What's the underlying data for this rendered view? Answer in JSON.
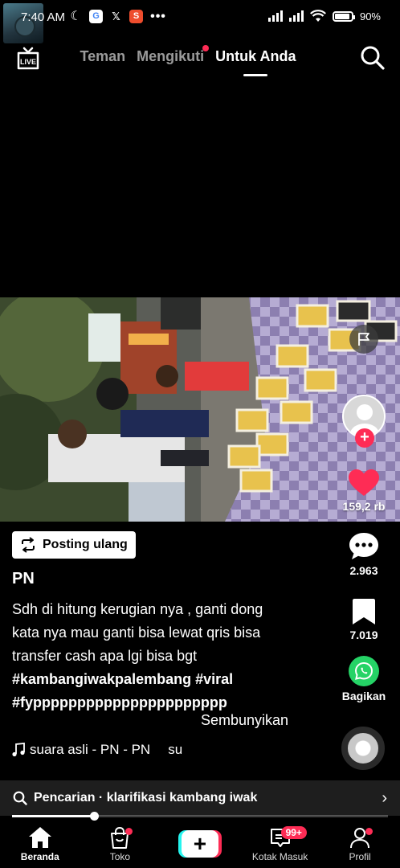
{
  "status_bar": {
    "time": "7:40 AM",
    "battery": "90%",
    "icons": [
      "moon-icon",
      "google-icon",
      "x-icon",
      "shopee-icon",
      "more-dots-icon",
      "signal-icon",
      "signal-icon",
      "wifi-icon",
      "battery-icon"
    ],
    "google_letter": "G",
    "x_letter": "𝕏",
    "shop_letter": "S",
    "dots": "•••",
    "moon": "☾"
  },
  "top_nav": {
    "tabs": [
      {
        "label": "Teman",
        "active": false
      },
      {
        "label": "Mengikuti",
        "active": false,
        "dot": true
      },
      {
        "label": "Untuk Anda",
        "active": true
      }
    ]
  },
  "actions": {
    "likes": "159,2 rb",
    "comments": "2.963",
    "bookmarks": "7.019",
    "share_label": "Bagikan"
  },
  "post": {
    "repost_label": "Posting ulang",
    "username": "PN",
    "caption_lines": [
      "Sdh di hitung kerugian nya , ganti dong",
      "kata nya mau ganti bisa lewat qris bisa",
      "transfer cash apa lgi bisa bgt"
    ],
    "hashtags_line1": "#kambangiwakpalembang #viral",
    "hashtags_line2": "#fypppppppppppppppppppppp",
    "hide_label": "Sembunyikan",
    "sound": "suara asli - PN - PN",
    "sound_extra": "su"
  },
  "search_suggestion": {
    "text": "Pencarian · klarifikasi kambang iwak"
  },
  "playback": {
    "progress": 0.22
  },
  "bottom_nav": {
    "items": [
      {
        "label": "Beranda",
        "active": true
      },
      {
        "label": "Toko"
      },
      {
        "label": ""
      },
      {
        "label": "Kotak Masuk",
        "badge": "99+"
      },
      {
        "label": "Profil"
      }
    ]
  },
  "colors": {
    "accent": "#fe2c55",
    "cyan": "#25f4ee",
    "whatsapp": "#25d366",
    "background": "#000000"
  }
}
